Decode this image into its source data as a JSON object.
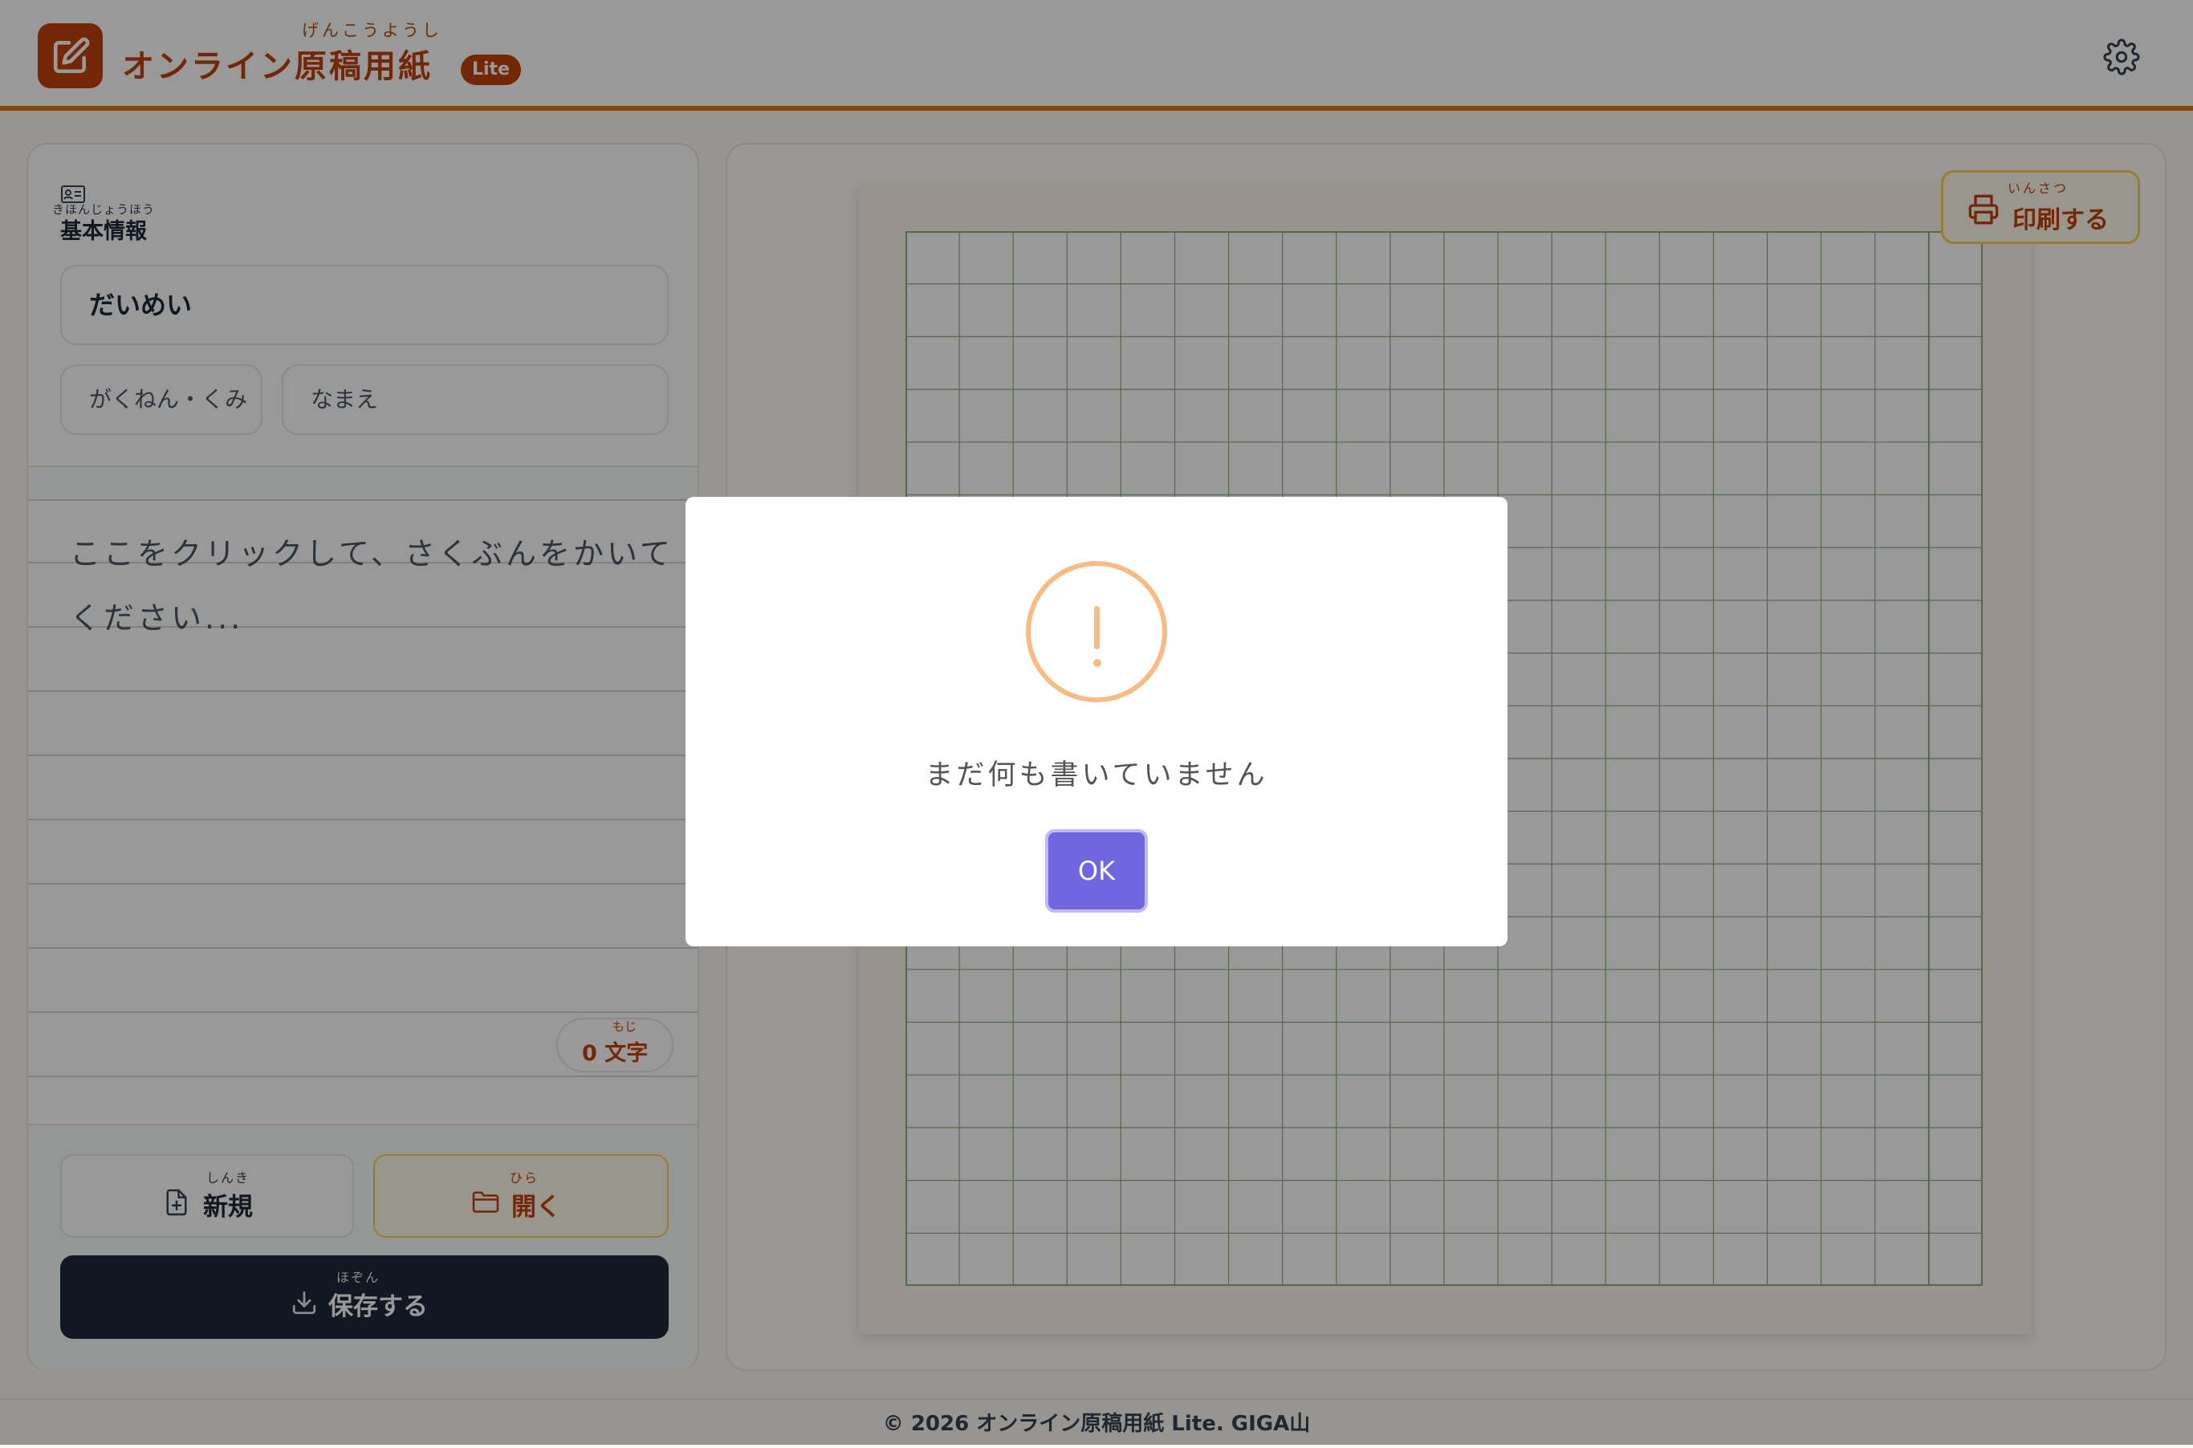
{
  "header": {
    "app_title": "オンライン原稿用紙",
    "app_title_ruby": "げんこうようし",
    "badge": "Lite"
  },
  "sidebar": {
    "section_title": "基本情報",
    "section_title_ruby": "きほんじょうほう",
    "title_value": "だいめい",
    "grade_placeholder": "がくねん・くみ",
    "name_placeholder": "なまえ",
    "essay_placeholder": "ここをクリックして、さくぶんをかいてください...",
    "char_count": "0",
    "char_unit": "文字",
    "char_unit_ruby": "もじ",
    "new_label": "新規",
    "new_ruby": "しんき",
    "open_label": "開く",
    "open_ruby": "ひら",
    "save_label": "保存する",
    "save_ruby": "ほぞん"
  },
  "main": {
    "print_label": "印刷する",
    "print_ruby": "いんさつ",
    "grid_columns": 20,
    "grid_rows": 20
  },
  "modal": {
    "message": "まだ何も書いていません",
    "ok_label": "OK",
    "icon": "warning-icon"
  },
  "footer": {
    "text": "© 2026 オンライン原稿用紙 Lite. GIGA山"
  },
  "colors": {
    "brand": "#c2410c",
    "accent_border": "#d97706",
    "grid_line": "#8fae7a",
    "ok_button": "#7066e0",
    "warning": "#f8bb86"
  }
}
